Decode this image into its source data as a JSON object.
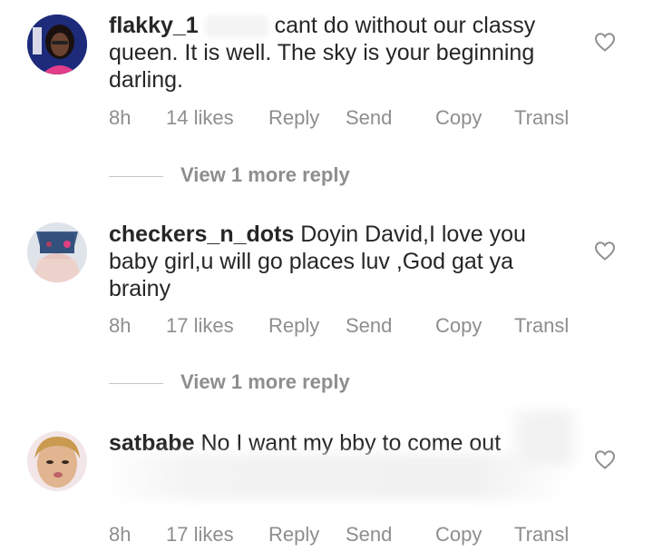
{
  "comments": [
    {
      "username": "flakky_1",
      "text": "cant do without our classy queen. It is well. The sky is your beginning darling.",
      "time": "8h",
      "likes": "14 likes",
      "actions": {
        "reply": "Reply",
        "send": "Send",
        "copy": "Copy",
        "translate": "Transl"
      },
      "view_more": "View 1 more reply"
    },
    {
      "username": "checkers_n_dots",
      "text": "Doyin David,I love you baby girl,u will go places luv ,God gat ya brainy",
      "time": "8h",
      "likes": "17 likes",
      "actions": {
        "reply": "Reply",
        "send": "Send",
        "copy": "Copy",
        "translate": "Transl"
      },
      "view_more": "View 1 more reply"
    },
    {
      "username": "satbabe",
      "text": "No I want my bby to come out",
      "time": "8h",
      "likes": "17 likes",
      "actions": {
        "reply": "Reply",
        "send": "Send",
        "copy": "Copy",
        "translate": "Transl"
      }
    }
  ],
  "icons": {
    "like": "heart-outline-icon"
  },
  "colors": {
    "text": "#262626",
    "meta": "#8e8e8e",
    "divider": "#c7c7c7"
  }
}
